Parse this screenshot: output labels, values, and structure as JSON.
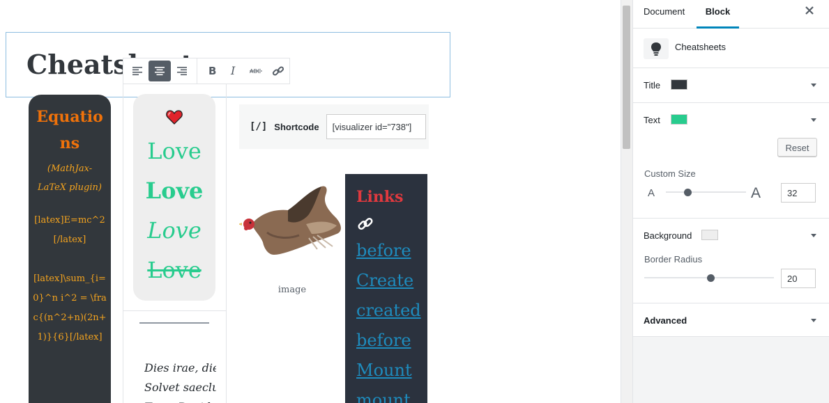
{
  "editor": {
    "title": "Cheatsheets",
    "toolbar": {
      "buttons": [
        "align-left-icon",
        "align-center-icon",
        "align-right-icon",
        "bold-icon",
        "italic-icon",
        "strikethrough-icon",
        "link-icon"
      ]
    },
    "equations": {
      "title": "Equations",
      "subtitle": "(MathJax-LaTeX plugin)",
      "formula1": "[latex]E=mc^2[/latex]",
      "formula2": "[latex]\\sum_{i=0}^n i^2 = \\frac{(n^2+n)(2n+1)}{6}[/latex]"
    },
    "love": {
      "words": [
        "Love",
        "Love",
        "Love",
        "Love"
      ]
    },
    "poem": {
      "lines": [
        "Dies irae, dies illa",
        "Solvet saeclum in favilla",
        "Teste David cum Sibylla"
      ]
    },
    "shortcode": {
      "icon": "[/]",
      "label": "Shortcode",
      "value": "[visualizer id=\"738\"]"
    },
    "image": {
      "caption": "image"
    },
    "links": {
      "title": "Links",
      "items": [
        "before",
        "Create",
        "created",
        "before",
        "Mount",
        "mount"
      ]
    }
  },
  "sidebar": {
    "tabs": {
      "document": "Document",
      "block": "Block"
    },
    "block_name": "Cheatsheets",
    "title_label": "Title",
    "text_label": "Text",
    "reset_label": "Reset",
    "custom_size_label": "Custom Size",
    "size_small_glyph": "A",
    "size_large_glyph": "A",
    "custom_size_value": "32",
    "background_label": "Background",
    "border_radius_label": "Border Radius",
    "border_radius_value": "20",
    "advanced_label": "Advanced",
    "colors": {
      "title": "#32373c",
      "text": "#28cc8e",
      "background": "#eeeeee",
      "accent": "#0085ba"
    }
  }
}
